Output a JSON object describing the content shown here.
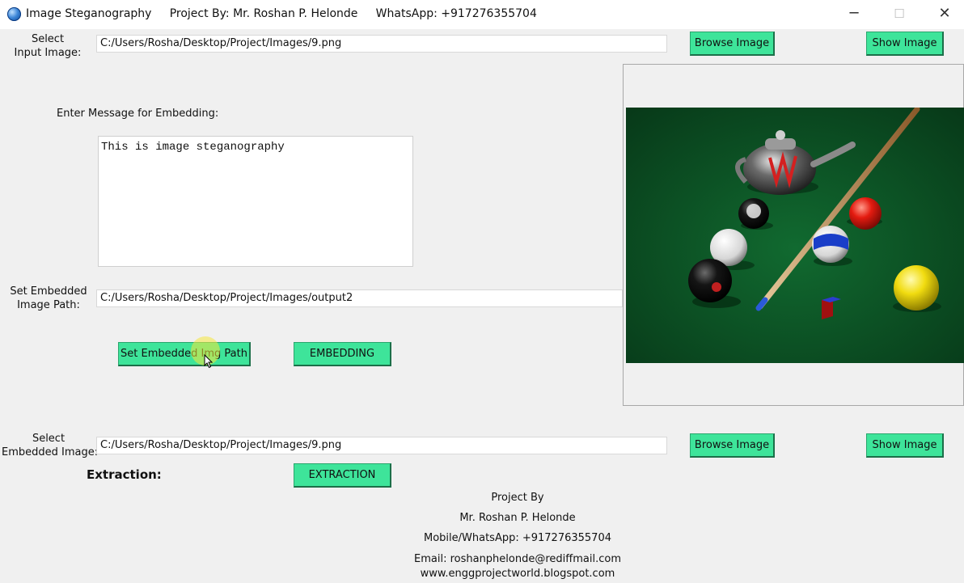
{
  "window": {
    "title": "Image Steganography     Project By: Mr. Roshan P. Helonde     WhatsApp: +917276355704",
    "minimize_glyph": "─",
    "maximize_glyph": "☐",
    "close_glyph": "✕"
  },
  "input_image": {
    "label_line1": "Select",
    "label_line2": "Input Image:",
    "path": "C:/Users/Rosha/Desktop/Project/Images/9.png",
    "browse_label": "Browse Image",
    "show_label": "Show Image"
  },
  "message": {
    "label": "Enter Message for Embedding:",
    "text": "This is image steganography"
  },
  "embedded_path": {
    "label_line1": "Set Embedded",
    "label_line2": "Image Path:",
    "path": "C:/Users/Rosha/Desktop/Project/Images/output2",
    "set_button_label": "Set Embedded Img Path",
    "embedding_button_label": "EMBEDDING"
  },
  "extraction_section": {
    "label_line1": "Select",
    "label_line2": "Embedded Image:",
    "path": "C:/Users/Rosha/Desktop/Project/Images/9.png",
    "browse_label": "Browse Image",
    "show_label": "Show Image",
    "heading": "Extraction:",
    "extraction_button_label": "EXTRACTION"
  },
  "footer": {
    "line1": "Project By",
    "line2": "Mr. Roshan P. Helonde",
    "line3": "Mobile/WhatsApp: +917276355704",
    "line4": "Email: roshanphelonde@rediffmail.com",
    "line5": "www.enggprojectworld.blogspot.com"
  },
  "colors": {
    "button_bg": "#3ee49a",
    "window_bg": "#f0f0f0",
    "preview_table": "#0c4e24"
  }
}
